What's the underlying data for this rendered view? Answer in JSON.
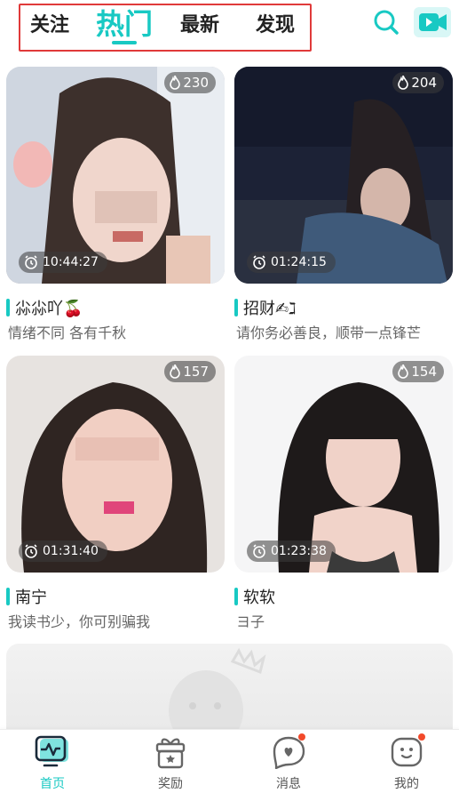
{
  "header": {
    "tabs": [
      {
        "label": "关注",
        "active": false
      },
      {
        "label": "热门",
        "active": true
      },
      {
        "label": "最新",
        "active": false
      },
      {
        "label": "发现",
        "active": false
      }
    ],
    "search_icon": "search-icon",
    "video_icon": "video-camera-icon"
  },
  "feed": [
    {
      "heat": "230",
      "duration": "10:44:27",
      "name": "尛尛吖🍒",
      "subtitle": "情绪不同 各有千秋"
    },
    {
      "heat": "204",
      "duration": "01:24:15",
      "name": "招财✍ℷ",
      "subtitle": "请你务必善良，顺带一点锋芒"
    },
    {
      "heat": "157",
      "duration": "01:31:40",
      "name": "南宁",
      "subtitle": "我读书少，你可别骗我"
    },
    {
      "heat": "154",
      "duration": "01:23:38",
      "name": "软软",
      "subtitle": "ヨ子"
    }
  ],
  "bottom_nav": [
    {
      "label": "首页",
      "icon": "home-monitor-icon",
      "active": true,
      "badge": false
    },
    {
      "label": "奖励",
      "icon": "gift-box-icon",
      "active": false,
      "badge": false
    },
    {
      "label": "消息",
      "icon": "message-heart-icon",
      "active": false,
      "badge": true
    },
    {
      "label": "我的",
      "icon": "profile-face-icon",
      "active": false,
      "badge": true
    }
  ],
  "colors": {
    "accent": "#18c9c3",
    "highlight_box": "#e03a3a",
    "badge": "#f24a2b"
  }
}
